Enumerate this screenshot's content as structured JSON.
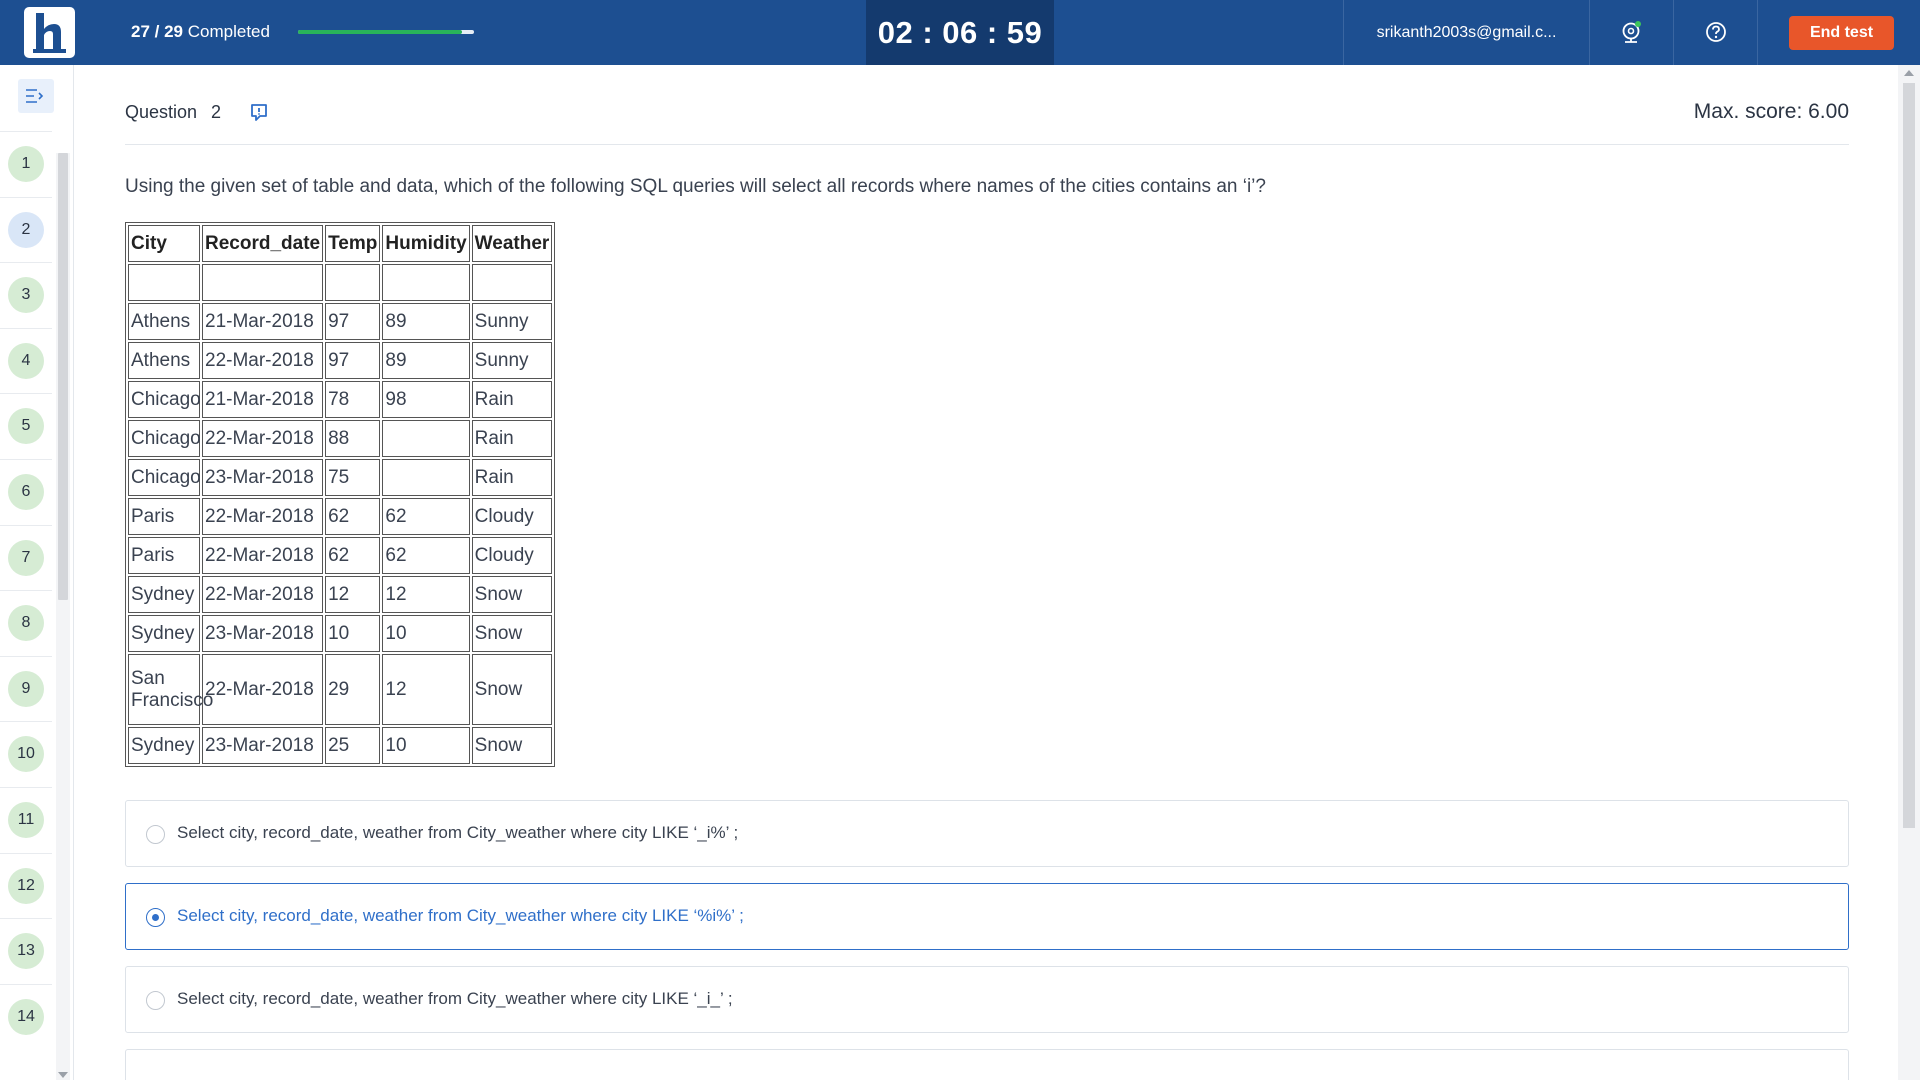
{
  "header": {
    "progress_count": "27 / 29",
    "progress_word": "Completed",
    "progress_fraction": 0.93,
    "timer": "02 : 06 : 59",
    "email": "srikanth2003s@gmail.c...",
    "webcam_icon": "webcam-icon",
    "help_icon": "help-icon",
    "end_button": "End test",
    "colors": {
      "bar": "#1d4f91",
      "progress": "#29b35a",
      "end_button": "#e8562a"
    }
  },
  "sidebar": {
    "collapse_icon": "collapse-menu-icon",
    "questions": [
      "1",
      "2",
      "3",
      "4",
      "5",
      "6",
      "7",
      "8",
      "9",
      "10",
      "11",
      "12",
      "13",
      "14"
    ],
    "current": "2"
  },
  "question": {
    "label": "Question",
    "number": "2",
    "max_score": "Max. score: 6.00",
    "text": "Using the given set of table and data, which of the following SQL queries will select all records where names of the cities contains an ‘i’?",
    "table": {
      "headers": [
        "City",
        "Record_date",
        "Temp",
        "Humidity",
        "Weather"
      ],
      "rows": [
        [
          "",
          "",
          "",
          "",
          ""
        ],
        [
          "Athens",
          "21-Mar-2018",
          "97",
          "89",
          "Sunny"
        ],
        [
          "Athens",
          "22-Mar-2018",
          "97",
          "89",
          "Sunny"
        ],
        [
          "Chicago",
          "21-Mar-2018",
          "78",
          "98",
          "Rain"
        ],
        [
          "Chicago",
          "22-Mar-2018",
          "88",
          "",
          "Rain"
        ],
        [
          "Chicago",
          "23-Mar-2018",
          "75",
          "",
          "Rain"
        ],
        [
          "Paris",
          "22-Mar-2018",
          "62",
          "62",
          "Cloudy"
        ],
        [
          "Paris",
          "22-Mar-2018",
          "62",
          "62",
          "Cloudy"
        ],
        [
          "Sydney",
          "22-Mar-2018",
          "12",
          "12",
          "Snow"
        ],
        [
          "Sydney",
          "23-Mar-2018",
          "10",
          "10",
          "Snow"
        ],
        [
          "San Francisco",
          "22-Mar-2018",
          "29",
          "12",
          "Snow"
        ],
        [
          "Sydney",
          "23-Mar-2018",
          "25",
          "10",
          "Snow"
        ]
      ]
    },
    "options": [
      "Select city, record_date, weather from City_weather where city LIKE ‘_i%’ ;",
      "Select city, record_date, weather from City_weather where city LIKE ‘%i%’ ;",
      "Select city, record_date, weather from City_weather where city LIKE ‘_i_’ ;"
    ],
    "selected_option": 1
  }
}
